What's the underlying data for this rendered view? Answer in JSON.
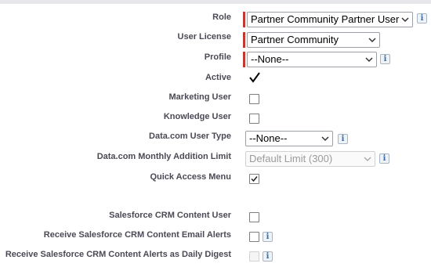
{
  "form": {
    "role": {
      "label": "Role",
      "value": "Partner Community Partner User"
    },
    "user_license": {
      "label": "User License",
      "value": "Partner Community"
    },
    "profile": {
      "label": "Profile",
      "value": "--None--"
    },
    "active": {
      "label": "Active",
      "checked": true
    },
    "marketing_user": {
      "label": "Marketing User",
      "checked": false
    },
    "knowledge_user": {
      "label": "Knowledge User",
      "checked": false
    },
    "datacom_user_type": {
      "label": "Data.com User Type",
      "value": "--None--"
    },
    "datacom_monthly_limit": {
      "label": "Data.com Monthly Addition Limit",
      "value": "Default Limit (300)"
    },
    "quick_access_menu": {
      "label": "Quick Access Menu",
      "checked": true
    },
    "crm_content_user": {
      "label": "Salesforce CRM Content User",
      "checked": false
    },
    "crm_content_email_alerts": {
      "label": "Receive Salesforce CRM Content Email Alerts",
      "checked": false
    },
    "crm_content_daily_digest": {
      "label": "Receive Salesforce CRM Content Alerts as Daily Digest",
      "checked": false
    }
  },
  "info_icon_glyph": "i",
  "colors": {
    "required_bar": "#c23934",
    "info_icon": "#3a6ba8"
  }
}
